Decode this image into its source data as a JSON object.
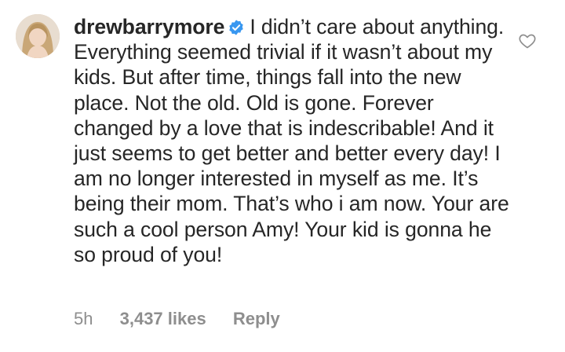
{
  "comment": {
    "username": "drewbarrymore",
    "verified_icon": "verified-badge-icon",
    "text": "I didn’t care about anything. Everything seemed trivial if it wasn’t about my kids. But after time, things fall into the new place. Not the old. Old is gone. Forever changed by a love that is indescribable! And it just seems to get better and better every day! I am no longer interested in myself as me. It’s being their mom. That’s who i am now. Your are such a cool person Amy! Your kid is gonna he so proud of you!",
    "time": "5h",
    "likes": "3,437 likes",
    "reply_label": "Reply",
    "like_icon": "heart-outline-icon"
  },
  "colors": {
    "text": "#262626",
    "muted": "#8e8e8e",
    "verified": "#3897f0"
  }
}
